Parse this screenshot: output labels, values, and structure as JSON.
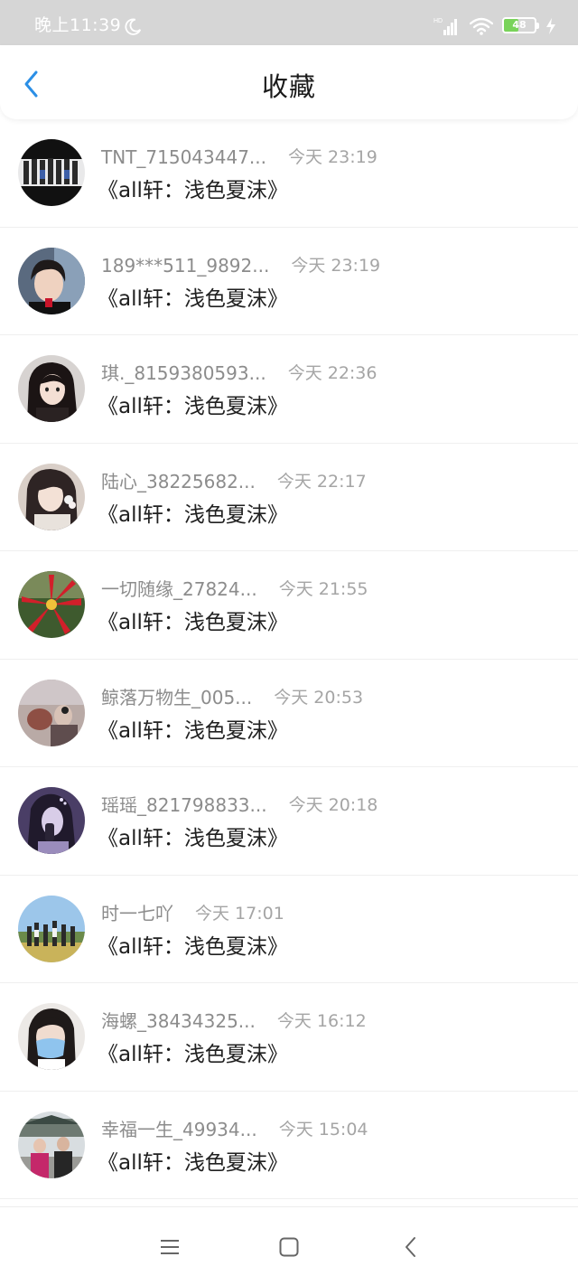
{
  "status_bar": {
    "time": "晚上11:39",
    "battery_level": "48",
    "battery_fraction": 0.48,
    "icons": [
      "moon-icon",
      "signal-icon",
      "wifi-icon",
      "battery-icon",
      "bolt-icon"
    ]
  },
  "header": {
    "title": "收藏",
    "back_icon": "chevron-left-icon"
  },
  "favorites": [
    {
      "user": "TNT_715043447...",
      "time": "今天 23:19",
      "title": "《all轩：浅色夏沫》",
      "avatar": "group-photo-avatar"
    },
    {
      "user": "189***511_9892...",
      "time": "今天 23:19",
      "title": "《all轩：浅色夏沫》",
      "avatar": "portrait-avatar"
    },
    {
      "user": "琪._8159380593...",
      "time": "今天 22:36",
      "title": "《all轩：浅色夏沫》",
      "avatar": "portrait-avatar"
    },
    {
      "user": "陆心_38225682...",
      "time": "今天 22:17",
      "title": "《all轩：浅色夏沫》",
      "avatar": "illustration-avatar"
    },
    {
      "user": "一切随缘_27824...",
      "time": "今天 21:55",
      "title": "《all轩：浅色夏沫》",
      "avatar": "red-flower-avatar"
    },
    {
      "user": "鲸落万物生_005...",
      "time": "今天 20:53",
      "title": "《all轩：浅色夏沫》",
      "avatar": "photo-avatar"
    },
    {
      "user": "瑶瑶_821798833...",
      "time": "今天 20:18",
      "title": "《all轩：浅色夏沫》",
      "avatar": "purple-portrait-avatar"
    },
    {
      "user": "时一七吖",
      "time": "今天 17:01",
      "title": "《all轩：浅色夏沫》",
      "avatar": "group-outdoor-avatar"
    },
    {
      "user": "海螺_38434325...",
      "time": "今天 16:12",
      "title": "《all轩：浅色夏沫》",
      "avatar": "masked-portrait-avatar"
    },
    {
      "user": "幸福一生_49934...",
      "time": "今天 15:04",
      "title": "《all轩：浅色夏沫》",
      "avatar": "couple-photo-avatar"
    }
  ],
  "nav_bar": {
    "icons": [
      "menu-icon",
      "home-icon",
      "back-triangle-icon"
    ]
  },
  "colors": {
    "accent": "#2b8fe6",
    "status_bar_bg": "#d6d6d6",
    "battery_fill": "#79d35a",
    "username_text": "#8c8c8c",
    "timestamp_text": "#a5a5a5"
  }
}
